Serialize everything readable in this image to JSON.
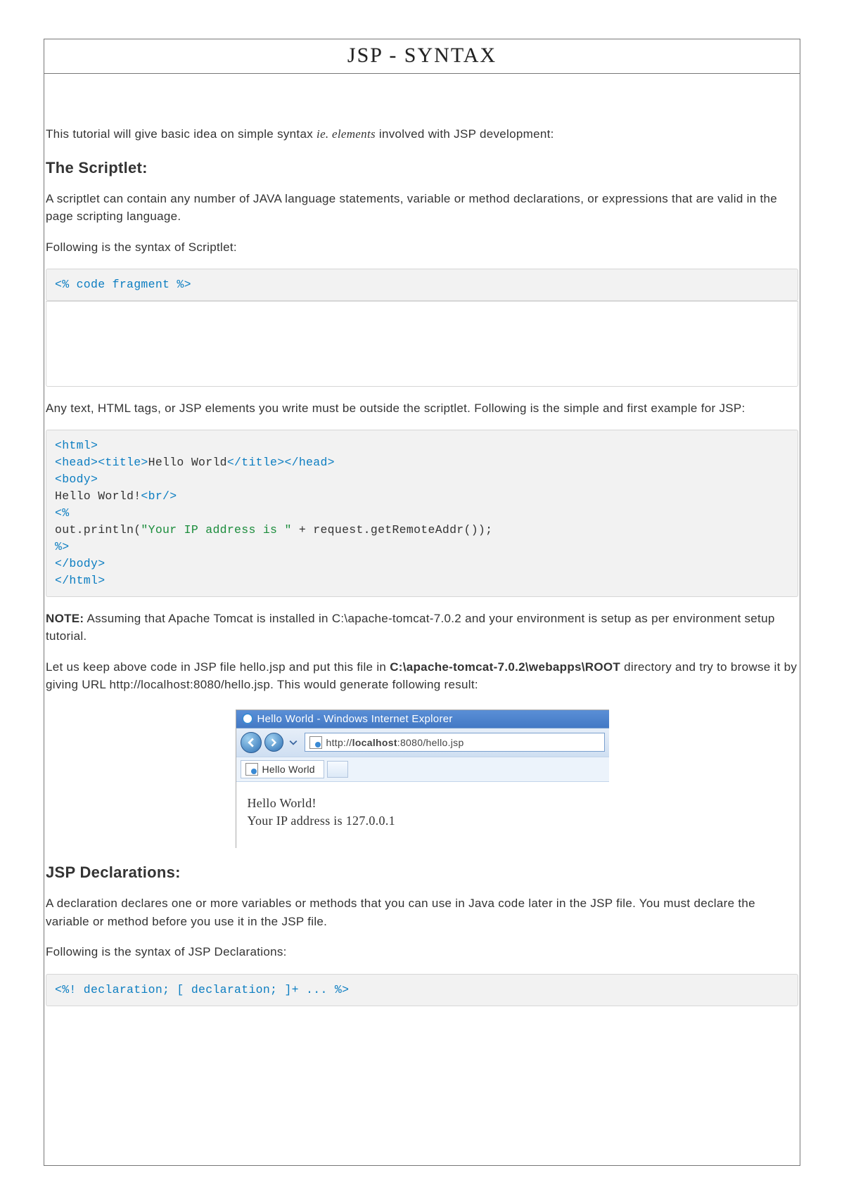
{
  "title": "JSP - SYNTAX",
  "intro_pre": "This tutorial will give basic idea on simple syntax ",
  "intro_italic": "ie. elements",
  "intro_post": " involved with JSP development:",
  "h_scriptlet": "The Scriptlet:",
  "p_scriptlet_1": "A scriptlet can contain any number of JAVA language statements, variable or method declarations, or expressions that are valid in the page scripting language.",
  "p_scriptlet_2": "Following is the syntax of Scriptlet:",
  "code_scriptlet": "<% code fragment %>",
  "p_scriptlet_3": "Any text, HTML tags, or JSP elements you write must be outside the scriptlet. Following is the simple and first example for JSP:",
  "code_hello": {
    "l1": "<html>",
    "l2a": "<head><title>",
    "l2b": "Hello World",
    "l2c": "</title></head>",
    "l3": "<body>",
    "l4a": "Hello World!",
    "l4b": "<br/>",
    "l5": "<%",
    "l6a": "out.println(",
    "l6b": "\"Your IP address is \"",
    "l6c": " + request.getRemoteAddr());",
    "l7": "%>",
    "l8": "</body>",
    "l9": "</html>"
  },
  "note_label": "NOTE:",
  "note_text": " Assuming that Apache Tomcat is installed in C:\\apache-tomcat-7.0.2 and your environment is setup as per environment setup tutorial.",
  "p_keepcode_pre": "Let us keep above code in JSP file hello.jsp and put this file in ",
  "p_keepcode_bold": "C:\\apache-tomcat-7.0.2\\webapps\\ROOT",
  "p_keepcode_post": " directory and try to browse it by giving URL http://localhost:8080/hello.jsp. This would generate following result:",
  "browser": {
    "title": "Hello World - Windows Internet Explorer",
    "url_pre": "http://",
    "url_bold": "localhost",
    "url_post": ":8080/hello.jsp",
    "tab": "Hello World",
    "out_line1": "Hello World!",
    "out_line2": "Your IP address is 127.0.0.1"
  },
  "h_decl": "JSP Declarations:",
  "p_decl_1": "A declaration declares one or more variables or methods that you can use in Java code later in the JSP file. You must declare the variable or method before you use it in the JSP file.",
  "p_decl_2": "Following is the syntax of JSP Declarations:",
  "code_decl": "<%! declaration; [ declaration; ]+ ... %>"
}
